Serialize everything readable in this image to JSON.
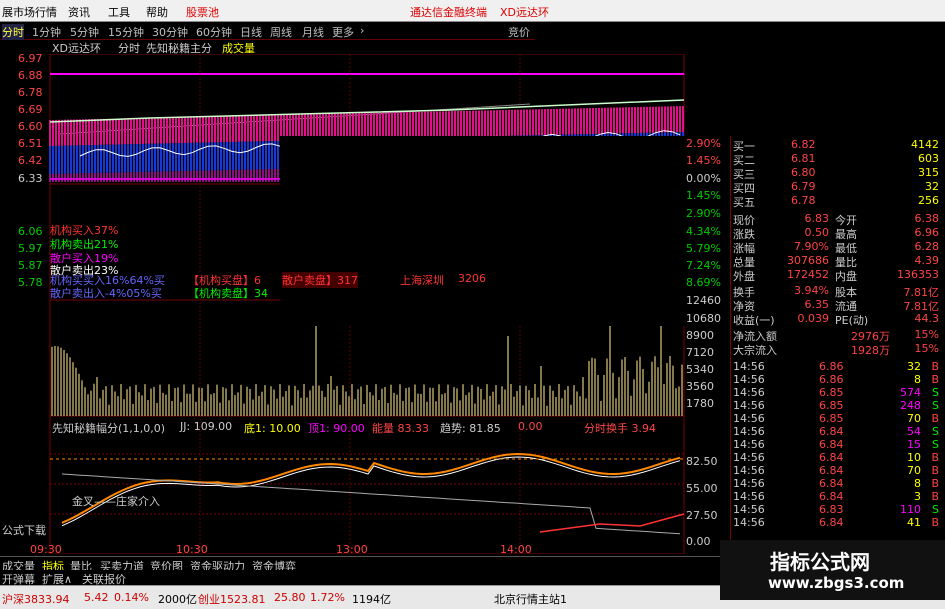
{
  "menubar": {
    "items": [
      "展市场行情",
      "资讯",
      "工具",
      "帮助",
      "股票池"
    ],
    "right_items": [
      "通达信金融终端",
      "XD远达环"
    ]
  },
  "periods": [
    "分时",
    "1分钟",
    "5分钟",
    "15分钟",
    "30分钟",
    "60分钟",
    "日线",
    "周线",
    "月线",
    "更多",
    "竞价"
  ],
  "chart_header": {
    "stock": "XD远达环",
    "label1": "分时",
    "label2": "先知秘籍主分",
    "label3": "成交量"
  },
  "price_axis": [
    "6.97",
    "6.88",
    "6.78",
    "6.69",
    "6.60",
    "6.51",
    "6.42",
    "6.33",
    "6.06",
    "5.97",
    "5.87",
    "5.78"
  ],
  "pct_axis": [
    "2.90%",
    "1.45%",
    "0.00%",
    "1.45%",
    "2.90%",
    "4.34%",
    "5.79%",
    "7.24%",
    "8.69%"
  ],
  "vol_axis": [
    "12460",
    "10680",
    "8900",
    "7120",
    "5340",
    "3560",
    "1780"
  ],
  "ind_axis": [
    "82.50",
    "55.00",
    "27.50",
    "0.00"
  ],
  "time_axis": [
    "09:30",
    "10:30",
    "13:00",
    "14:00"
  ],
  "legend": {
    "inst_buy": "机构买入37%",
    "inst_sell": "机构卖出21%",
    "retail_buy": "散户买入19%",
    "retail_sell": "散户卖出23%",
    "inst_ratio": "机构买买入16%64%买",
    "retail_ratio": "散户卖出入-4%05%买",
    "inst_buy_box": "【机构买盘】6",
    "retail_box": "散户卖盘】317",
    "index_label": "上海深圳",
    "num3206": "3206",
    "inst_sell_box": "【机构卖盘】34"
  },
  "indicator_header": {
    "name": "先知秘籍幅分(1,1,0,0)",
    "jj": "JJ: 109.00",
    "di": "底1: 10.00",
    "ding": "顶1: 90.00",
    "neng": "能量 83.33",
    "qushi": "趋势: 81.85",
    "zero": "0.00",
    "huanshou": "分时换手 3.94"
  },
  "indicator_text": "金叉——庄家介入",
  "formula_label": "公式下载",
  "quote": {
    "bids": [
      {
        "label": "买一",
        "price": "6.82",
        "vol": "4142"
      },
      {
        "label": "买二",
        "price": "6.81",
        "vol": "603"
      },
      {
        "label": "买三",
        "price": "6.80",
        "vol": "315"
      },
      {
        "label": "买四",
        "price": "6.79",
        "vol": "32"
      },
      {
        "label": "买五",
        "price": "6.78",
        "vol": "256"
      }
    ],
    "stats": [
      {
        "l1": "现价",
        "v1": "6.83",
        "l2": "今开",
        "v2": "6.38"
      },
      {
        "l1": "涨跌",
        "v1": "0.50",
        "l2": "最高",
        "v2": "6.96"
      },
      {
        "l1": "涨幅",
        "v1": "7.90%",
        "l2": "最低",
        "v2": "6.28"
      },
      {
        "l1": "总量",
        "v1": "307686",
        "l2": "量比",
        "v2": "4.39"
      },
      {
        "l1": "外盘",
        "v1": "172452",
        "l2": "内盘",
        "v2": "136353"
      },
      {
        "l1": "换手",
        "v1": "3.94%",
        "l2": "股本",
        "v2": "7.81亿"
      },
      {
        "l1": "净资",
        "v1": "6.35",
        "l2": "流通",
        "v2": "7.81亿"
      },
      {
        "l1": "收益(一)",
        "v1": "0.039",
        "l2": "PE(动)",
        "v2": "44.3"
      }
    ],
    "flows": [
      {
        "label": "净流入额",
        "value": "2976万",
        "pct": "15%"
      },
      {
        "label": "大宗流入",
        "value": "1928万",
        "pct": "15%"
      }
    ],
    "ticks": [
      {
        "t": "14:56",
        "p": "6.86",
        "v": "32",
        "s": "B"
      },
      {
        "t": "14:56",
        "p": "6.86",
        "v": "8",
        "s": "B"
      },
      {
        "t": "14:56",
        "p": "6.85",
        "v": "574",
        "s": "S"
      },
      {
        "t": "14:56",
        "p": "6.85",
        "v": "248",
        "s": "S"
      },
      {
        "t": "14:56",
        "p": "6.85",
        "v": "70",
        "s": "B"
      },
      {
        "t": "14:56",
        "p": "6.84",
        "v": "54",
        "s": "S"
      },
      {
        "t": "14:56",
        "p": "6.84",
        "v": "15",
        "s": "S"
      },
      {
        "t": "14:56",
        "p": "6.84",
        "v": "10",
        "s": "B"
      },
      {
        "t": "14:56",
        "p": "6.84",
        "v": "70",
        "s": "B"
      },
      {
        "t": "14:56",
        "p": "6.84",
        "v": "8",
        "s": "B"
      },
      {
        "t": "14:56",
        "p": "6.84",
        "v": "3",
        "s": "B"
      },
      {
        "t": "14:56",
        "p": "6.83",
        "v": "110",
        "s": "S"
      },
      {
        "t": "14:56",
        "p": "6.84",
        "v": "41",
        "s": "B"
      }
    ]
  },
  "bottom_tabs": [
    "成交量",
    "指标",
    "量比",
    "买卖力道",
    "竞价图",
    "资金驱动力",
    "资金博弈"
  ],
  "bottom_tabs2": [
    "开弹幕",
    "扩展∧",
    "关联报价"
  ],
  "status": {
    "index1": "沪深3833.94",
    "chg1": "5.42",
    "pct1": "0.14%",
    "amt1": "2000亿",
    "index2": "创业1523.81",
    "chg2": "25.80",
    "pct2": "1.72%",
    "amt2": "1194亿",
    "server": "北京行情主站1"
  },
  "watermark": {
    "title": "指标公式网",
    "url": "www.zbgs3.com"
  },
  "colors": {
    "magenta": "#ff00ff",
    "blue": "#2040ff",
    "red": "#ff3030",
    "green": "#00e000",
    "yellow": "#ffff40",
    "vol_bar": "#b0a060"
  }
}
